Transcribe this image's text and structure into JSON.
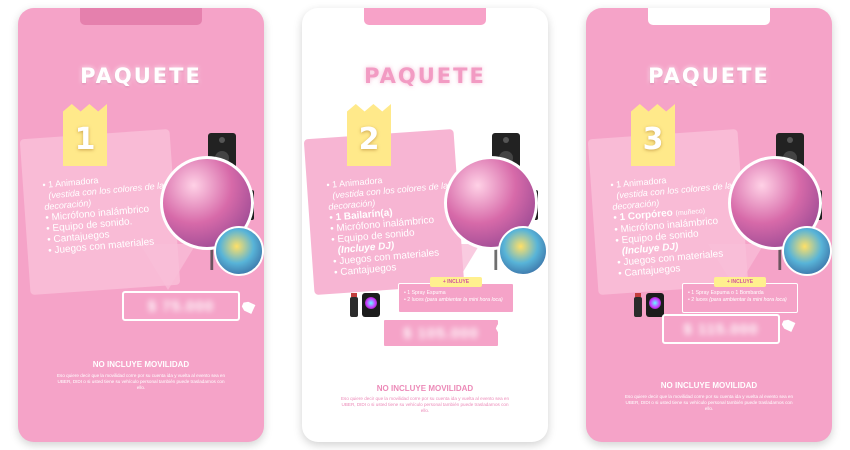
{
  "packages": [
    {
      "title": "PAQUETE",
      "number": "1",
      "items": [
        "1 Animadora",
        "(vestida con los colores de la decoración)",
        "Micrófono inalámbrico",
        "Equipo de sonido.",
        "Cantajuegos",
        "Juegos con materiales"
      ],
      "price": "$ 75.000",
      "no_mobility": "NO INCLUYE MOVILIDAD",
      "description": "Eso quiere decir que la movilidad corre por su cuenta ida y vuelta al evento sea en UBER, DIDI o si usted tiene su vehículo personal también puede trasladarnos con ello."
    },
    {
      "title": "PAQUETE",
      "number": "2",
      "items": [
        "1 Animadora",
        "(vestida con los colores de la decoración)",
        "1 Bailarín(a)",
        "Micrófono inalámbrico",
        "Equipo de sonido",
        "(Incluye DJ)",
        "Juegos con materiales",
        "Cantajuegos"
      ],
      "includes_label": "+ INCLUYE",
      "includes": [
        "1 Spray Espuma",
        "2 luces",
        "(para ambientar la mini hora loca)"
      ],
      "price": "$ 105.000",
      "no_mobility": "NO INCLUYE MOVILIDAD",
      "description": "Eso quiere decir que la movilidad corre por su cuenta ida y vuelta al evento sea en UBER, DIDI o si usted tiene su vehículo personal también puede trasladarnos con ello."
    },
    {
      "title": "PAQUETE",
      "number": "3",
      "items": [
        "1 Animadora",
        "(vestida con los colores de la decoración)",
        "1 Corpóreo",
        "(muñeco)",
        "Micrófono inalámbrico",
        "Equipo de sonido",
        "(Incluye DJ)",
        "Juegos con materiales",
        "Cantajuegos"
      ],
      "includes_label": "+ INCLUYE",
      "includes": [
        "1 Spray Espuma o 1 Bombarda",
        "2 luces",
        "(para ambientar la mini hora loca)"
      ],
      "price": "$ 115.000",
      "no_mobility": "NO INCLUYE MOVILIDAD",
      "description": "Eso quiere decir que la movilidad corre por su cuenta ida y vuelta al evento sea en UBER, DIDI o si usted tiene su vehículo personal también puede trasladarnos con ello."
    }
  ],
  "colors": {
    "pink": "#f5a3c8",
    "light_pink": "#f9bfd8",
    "yellow": "#ffe98a",
    "white": "#ffffff",
    "text_pink": "#ec8ab8"
  }
}
